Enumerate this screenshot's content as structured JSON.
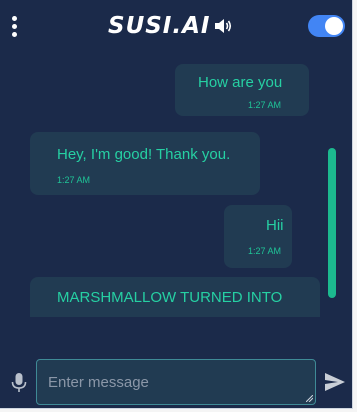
{
  "header": {
    "logo": "SUSI.AI",
    "menu_icon": "more-vert-icon",
    "speaker_icon": "volume-icon",
    "toggle_on": true
  },
  "messages": [
    {
      "sender": "user",
      "text": "How are you",
      "time": "1:27 AM"
    },
    {
      "sender": "bot",
      "text": "Hey, I'm good! Thank you.",
      "time": "1:27 AM"
    },
    {
      "sender": "user",
      "text": "Hii",
      "time": "1:27 AM"
    },
    {
      "sender": "bot",
      "text": "MARSHMALLOW TURNED INTO",
      "time": ""
    }
  ],
  "composer": {
    "placeholder": "Enter message",
    "mic_icon": "microphone-icon",
    "send_icon": "send-icon"
  },
  "colors": {
    "background": "#1b2a4a",
    "bubble": "#213b52",
    "accent_text": "#26d0a3",
    "scrollbar": "#1cb98f",
    "toggle": "#4285f4"
  }
}
